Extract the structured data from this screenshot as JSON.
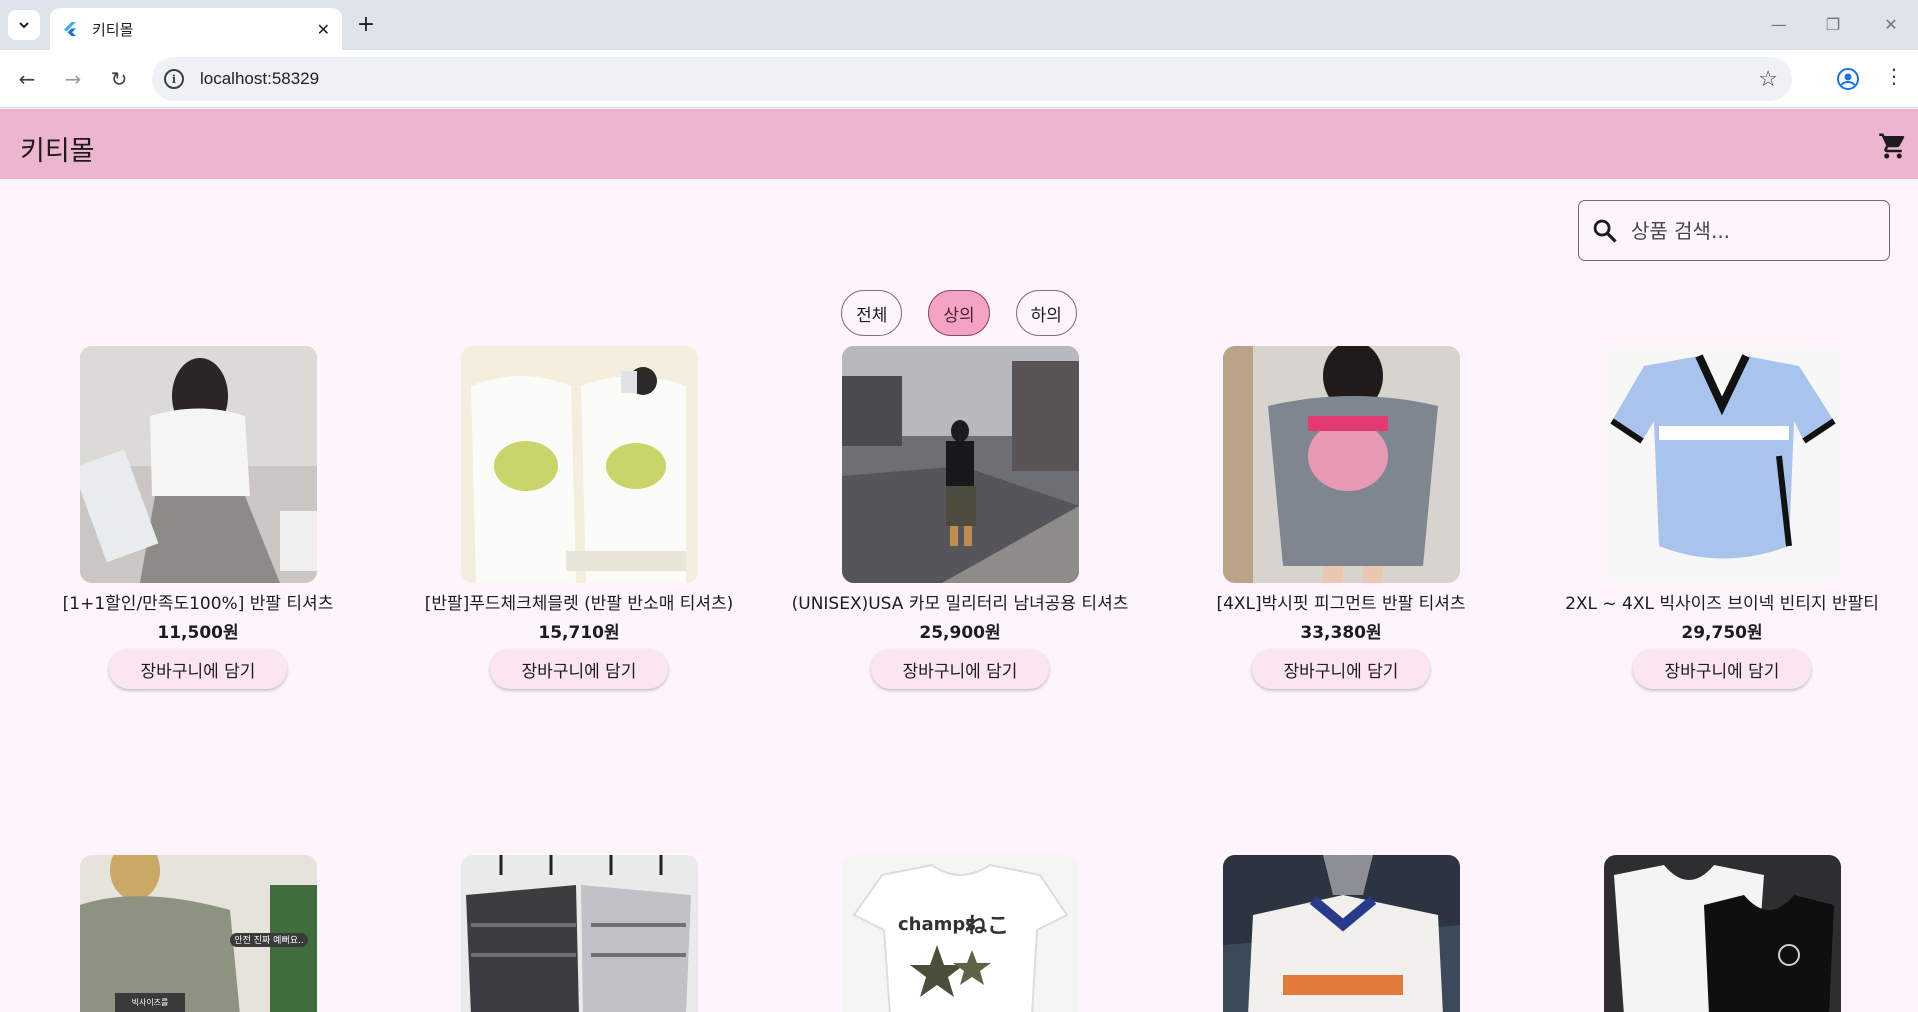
{
  "browser": {
    "tab_title": "키티몰",
    "url": "localhost:58329"
  },
  "app": {
    "title": "키티몰",
    "accent": "#edb5cf"
  },
  "search": {
    "placeholder": "상품 검색..."
  },
  "filters": [
    {
      "label": "전체",
      "selected": false
    },
    {
      "label": "상의",
      "selected": true
    },
    {
      "label": "하의",
      "selected": false
    }
  ],
  "products": [
    {
      "name": "[1+1할인/만족도100%] 반팔 티셔츠",
      "price": "11,500원",
      "button": "장바구니에 담기"
    },
    {
      "name": "[반팔]푸드체크체믈렛 (반팔 반소매 티셔츠)",
      "price": "15,710원",
      "button": "장바구니에 담기"
    },
    {
      "name": "(UNISEX)USA 카모 밀리터리 남녀공용 티셔츠",
      "price": "25,900원",
      "button": "장바구니에 담기"
    },
    {
      "name": "[4XL]박시핏 피그먼트 반팔 티셔츠",
      "price": "33,380원",
      "button": "장바구니에 담기"
    },
    {
      "name": "2XL ~ 4XL 빅사이즈 브이넥 빈티지 반팔티",
      "price": "29,750원",
      "button": "장바구니에 담기"
    }
  ],
  "image_texts": {
    "p6_caption": "안전 진짜 예뻐요..",
    "p6_caption2": "빅사이즈를",
    "p8_brand": "champs",
    "p8_kana": "ねこ"
  }
}
